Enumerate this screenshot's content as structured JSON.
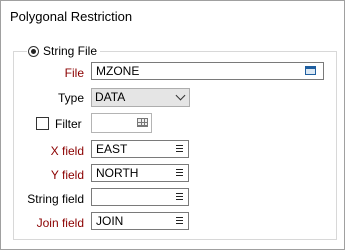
{
  "panel": {
    "title": "Polygonal Restriction"
  },
  "group": {
    "radio_label": "String File",
    "radio_selected": true
  },
  "file": {
    "label": "File",
    "value": "MZONE",
    "icon": "browse-icon"
  },
  "type": {
    "label": "Type",
    "value": "DATA",
    "icon": "chevron-down-icon"
  },
  "filter": {
    "label": "Filter",
    "checked": false,
    "value": "",
    "icon": "grid-icon"
  },
  "x_field": {
    "label": "X field",
    "value": "EAST",
    "icon": "list-icon"
  },
  "y_field": {
    "label": "Y field",
    "value": "NORTH",
    "icon": "list-icon"
  },
  "string_field": {
    "label": "String field",
    "value": "",
    "icon": "list-icon"
  },
  "join_field": {
    "label": "Join field",
    "value": "JOIN",
    "icon": "list-icon"
  },
  "colors": {
    "required_label": "#8b0000",
    "normal_label": "#000000",
    "browse_icon": "#1f5fa0"
  }
}
